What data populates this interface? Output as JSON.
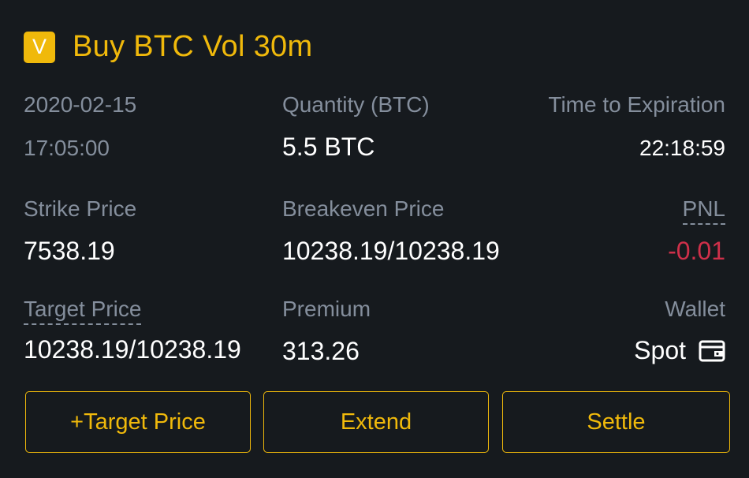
{
  "header": {
    "badge_letter": "V",
    "title": "Buy BTC Vol 30m"
  },
  "details": {
    "date": "2020-02-15",
    "time": "17:05:00",
    "quantity_label": "Quantity (BTC)",
    "quantity_value": "5.5 BTC",
    "expiration_label": "Time to Expiration",
    "expiration_value": "22:18:59",
    "strike_label": "Strike Price",
    "strike_value": "7538.19",
    "breakeven_label": "Breakeven Price",
    "breakeven_value": "10238.19/10238.19",
    "pnl_label": "PNL",
    "pnl_value": "-0.01",
    "target_label": "Target Price",
    "target_value": "10238.19/10238.19",
    "premium_label": "Premium",
    "premium_value": "313.26",
    "wallet_label": "Wallet",
    "wallet_value": "Spot",
    "wallet_icon": "wallet-icon"
  },
  "actions": {
    "target_price_button": "+Target Price",
    "extend_button": "Extend",
    "settle_button": "Settle"
  },
  "colors": {
    "background": "#161a1e",
    "accent": "#f0b90b",
    "label": "#848e9c",
    "value": "#ffffff",
    "negative": "#cf304a"
  }
}
